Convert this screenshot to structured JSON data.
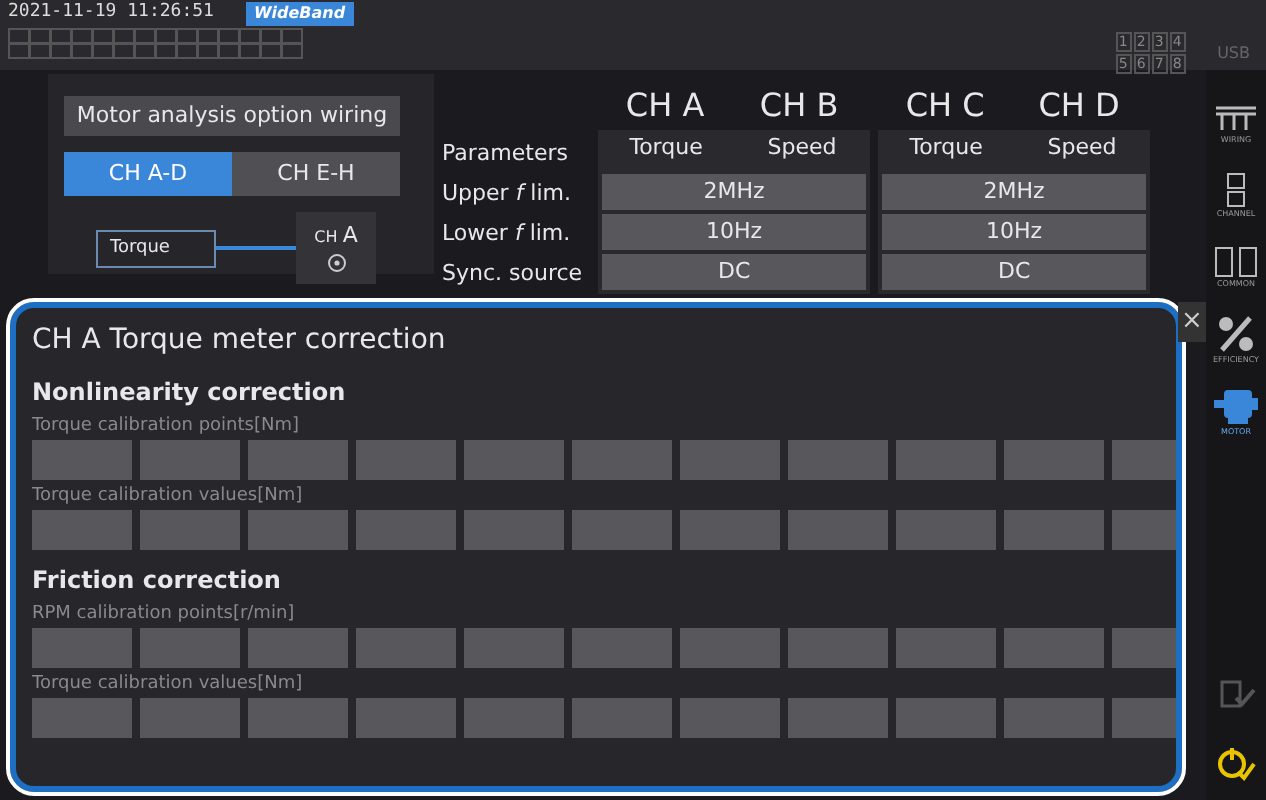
{
  "status_bar": {
    "datetime": "2021-11-19 11:26:51",
    "mode": "WideBand",
    "numbers": [
      "1",
      "2",
      "3",
      "4",
      "5",
      "6",
      "7",
      "8"
    ],
    "usb": "USB"
  },
  "wiring_panel": {
    "title": "Motor analysis option wiring",
    "tabs": [
      {
        "label": "CH A-D",
        "selected": true
      },
      {
        "label": "CH E-H",
        "selected": false
      }
    ],
    "diagram": {
      "sensor": "Torque",
      "channel_prefix": "CH",
      "channel_letter": "A"
    }
  },
  "channel_table": {
    "headers": [
      "CH A",
      "CH B",
      "CH C",
      "CH D"
    ],
    "rows": [
      {
        "label": "Parameters",
        "kind": "pair",
        "values": [
          "Torque",
          "Speed",
          "Torque",
          "Speed"
        ]
      },
      {
        "label": "Upper *f* lim.",
        "kind": "span",
        "values": [
          "2MHz",
          "2MHz"
        ]
      },
      {
        "label": "Lower *f* lim.",
        "kind": "span",
        "values": [
          "10Hz",
          "10Hz"
        ]
      },
      {
        "label": "Sync. source",
        "kind": "span",
        "values": [
          "DC",
          "DC"
        ]
      }
    ]
  },
  "sidebar": {
    "items": [
      {
        "label": "WIRING",
        "kind": "wiring",
        "selected": false
      },
      {
        "label": "CHANNEL",
        "kind": "channel",
        "selected": false
      },
      {
        "label": "COMMON",
        "kind": "common",
        "selected": false
      },
      {
        "label": "EFFICIENCY",
        "kind": "efficiency",
        "selected": false
      },
      {
        "label": "MOTOR",
        "kind": "motor",
        "selected": true
      }
    ],
    "bottom_items": [
      {
        "kind": "check",
        "disabled": true
      },
      {
        "kind": "switch",
        "disabled": false
      }
    ]
  },
  "dialog": {
    "title": "CH A  Torque meter correction",
    "close": "×",
    "sections": [
      {
        "title": "Nonlinearity correction",
        "rows": [
          {
            "label": "Torque calibration points[Nm]"
          },
          {
            "label": "Torque calibration values[Nm]"
          }
        ]
      },
      {
        "title": "Friction correction",
        "rows": [
          {
            "label": "RPM calibration points[r/min]"
          },
          {
            "label": "Torque calibration values[Nm]"
          }
        ]
      }
    ]
  }
}
